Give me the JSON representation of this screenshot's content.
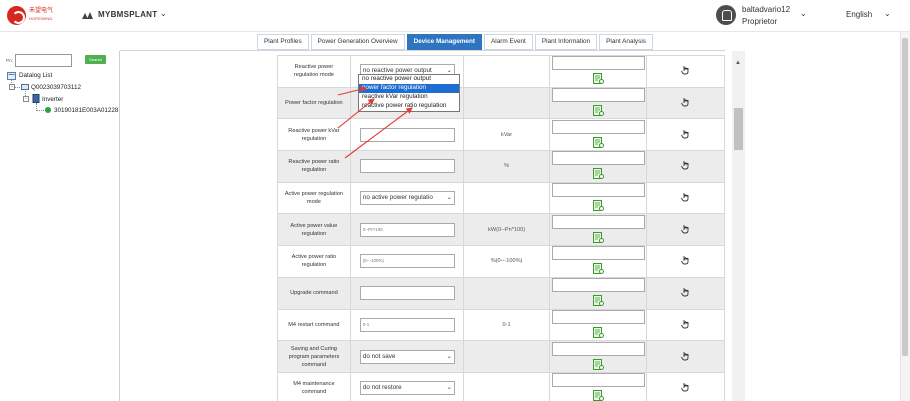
{
  "header": {
    "logo_text": "禾望电气",
    "logo_sub": "HOPEWIND",
    "plant_name": "MYBMSPLANT",
    "user_name": "baltadvario12",
    "user_role": "Proprietor",
    "language": "English"
  },
  "tabs": [
    {
      "label": "Plant Profiles",
      "active": false
    },
    {
      "label": "Power Generation Overview",
      "active": false
    },
    {
      "label": "Device Management",
      "active": true
    },
    {
      "label": "Alarm Event",
      "active": false
    },
    {
      "label": "Plant Information",
      "active": false
    },
    {
      "label": "Plant Analysis",
      "active": false
    }
  ],
  "tree": {
    "pn_label": "Pn:",
    "search_label": "Search",
    "root": "Datalog List",
    "datalog": "Q0023039703112",
    "group": "Inverter",
    "device": "30190181E003A01228"
  },
  "rows": [
    {
      "name": "Reactive power regulation mode",
      "control": "no reactive power output",
      "unit": ""
    },
    {
      "name": "Power factor regulation",
      "control": "",
      "unit": ""
    },
    {
      "name": "Reactive power kVar regulation",
      "control": "",
      "unit": "kVar"
    },
    {
      "name": "Reactive power ratio regulation",
      "control": "",
      "unit": "%"
    },
    {
      "name": "Active power regulation mode",
      "control": "no active power regulatio",
      "unit": ""
    },
    {
      "name": "Active power value regulation",
      "control": "0--Pn*100",
      "unit": "kW(0--Pn*100)"
    },
    {
      "name": "Active power ratio regulation",
      "control": "(0---100%)",
      "unit": "%(0---100%)"
    },
    {
      "name": "Upgrade command",
      "control": "",
      "unit": ""
    },
    {
      "name": "M4 restart command",
      "control": "0-1",
      "unit": "0-1"
    },
    {
      "name": "Saving and Curing program parameters command",
      "control": "do not save",
      "unit": ""
    },
    {
      "name": "M4 maintenance command",
      "control": "do not restore",
      "unit": ""
    }
  ],
  "dropdown": {
    "options": [
      "no reactive power output",
      "power factor regulation",
      "reactive kVar regulation",
      "reactive power ratio regulation"
    ],
    "highlighted": "power factor regulation"
  },
  "colors": {
    "accent": "#2f74c0",
    "brand": "#d7281f",
    "arrow": "#e53935",
    "dropdown_highlight": "#1e6ed2",
    "online": "#25a244"
  }
}
